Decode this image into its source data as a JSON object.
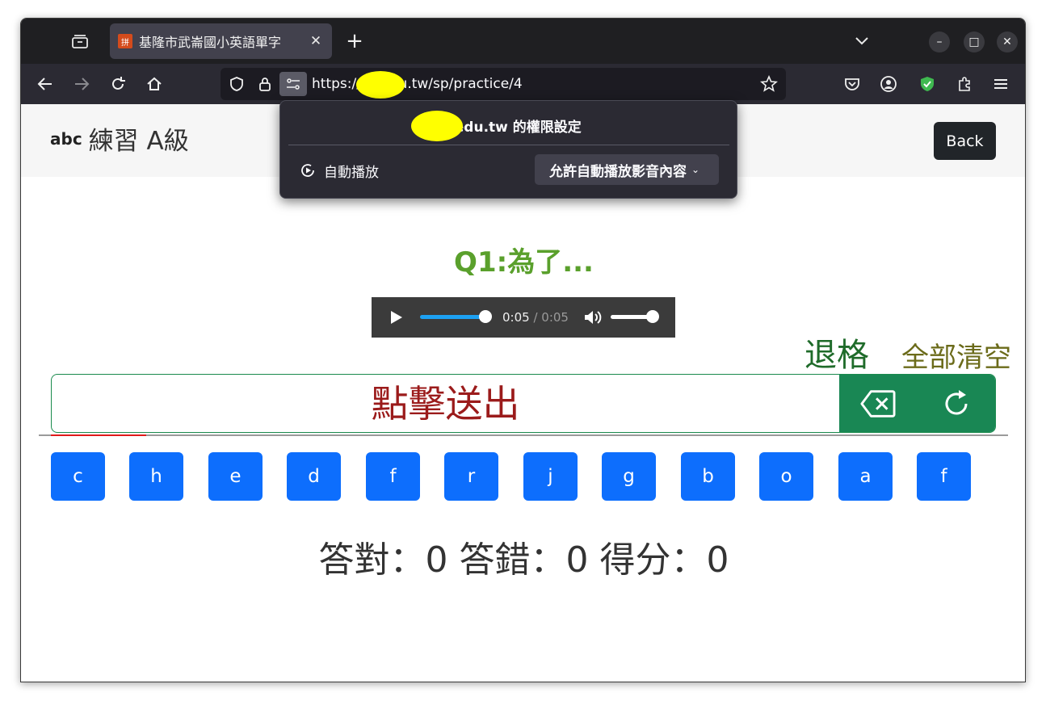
{
  "browser": {
    "tab": {
      "title": "基隆市武崙國小英語單字",
      "favicon_glyph": "拼",
      "close_glyph": "✕"
    },
    "new_tab_glyph": "+",
    "url": "https://      kl.edu.tw/sp/practice/4",
    "window_controls": {
      "minimize": "–",
      "maximize": "□",
      "close": "✕"
    }
  },
  "popup": {
    "title": "       kl.edu.tw 的權限設定",
    "autoplay_label": "自動播放",
    "autoplay_value": "允許自動播放影音內容",
    "chevron": "⌄"
  },
  "header": {
    "brand_icon": "abc",
    "title": "練習 A級",
    "back_label": "Back"
  },
  "question": {
    "text": "Q1:為了..."
  },
  "audio": {
    "current_time": "0:05",
    "duration": " / 0:05",
    "progress": 1.0,
    "volume": 1.0
  },
  "controls": {
    "backspace_label": "退格",
    "clear_label": "全部清空",
    "submit_label": "點擊送出"
  },
  "letters": [
    "c",
    "h",
    "e",
    "d",
    "f",
    "r",
    "j",
    "g",
    "b",
    "o",
    "a",
    "f"
  ],
  "score": {
    "text": "答對：0 答錯：0 得分：0"
  },
  "colors": {
    "question": "#5aa02c",
    "letter_button": "#0d6efd",
    "tool_bar": "#198754",
    "submit_text": "#9b1b1b"
  }
}
